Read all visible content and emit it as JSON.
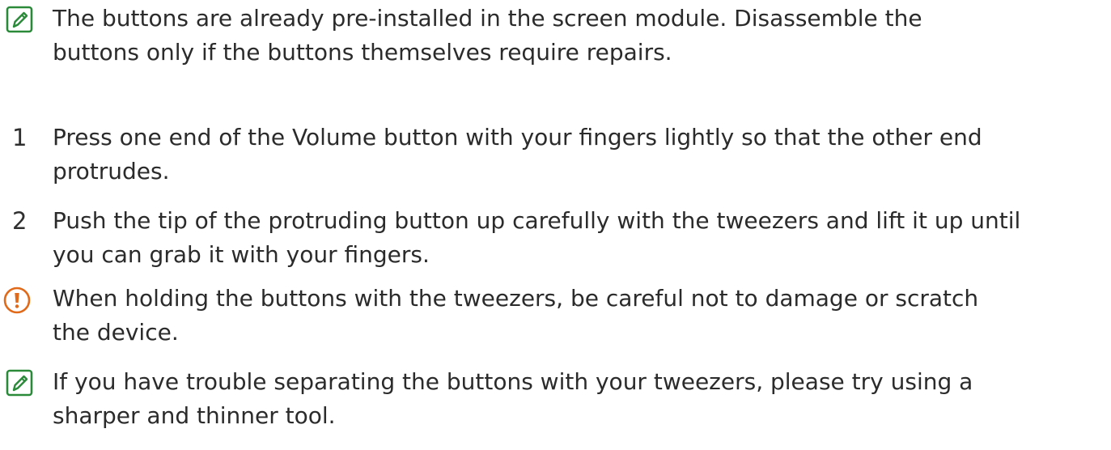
{
  "colors": {
    "text": "#2b2b2b",
    "note_icon": "#2a8a3a",
    "caution_icon": "#e06a1a"
  },
  "notes": [
    {
      "icon": "note-pencil-icon",
      "lines": [
        "The buttons are already pre-installed in the screen module. Disassemble the",
        "buttons only if the buttons themselves require repairs."
      ]
    },
    {
      "icon": "caution-icon",
      "lines": [
        "When holding the buttons with the tweezers, be careful not to damage or scratch",
        "the device."
      ]
    },
    {
      "icon": "note-pencil-icon",
      "lines": [
        "If you have trouble separating the buttons with your tweezers, please try using a",
        "sharper and thinner tool."
      ]
    }
  ],
  "steps": [
    {
      "number": "1",
      "lines": [
        "Press one end of the Volume button with your fingers lightly so that the other end",
        "protrudes."
      ]
    },
    {
      "number": "2",
      "lines": [
        "Push the tip of the protruding button up carefully with the tweezers and lift it up until",
        "you can grab it with your fingers."
      ]
    }
  ]
}
